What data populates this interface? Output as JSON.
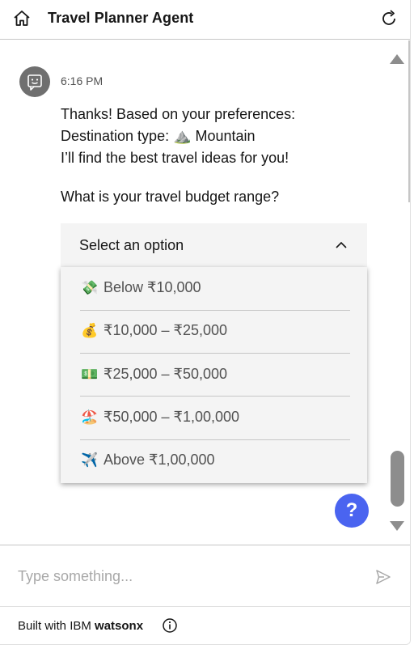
{
  "header": {
    "title": "Travel Planner Agent",
    "home_icon": "home-icon",
    "restart_icon": "restart-icon"
  },
  "chat": {
    "timestamp": "6:16 PM",
    "avatar_icon": "bot-face-icon",
    "messages": [
      "Thanks! Based on your preferences:",
      "Destination type: ⛰️ Mountain",
      "I’ll find the best travel ideas for you!",
      "What is your travel budget range?"
    ],
    "select": {
      "placeholder": "Select an option",
      "options": [
        {
          "emoji": "💸",
          "label": "Below ₹10,000"
        },
        {
          "emoji": "💰",
          "label": "₹10,000 – ₹25,000"
        },
        {
          "emoji": "💵",
          "label": "₹25,000 – ₹50,000"
        },
        {
          "emoji": "🏖️",
          "label": "₹50,000 – ₹1,00,000"
        },
        {
          "emoji": "✈️",
          "label": "Above ₹1,00,000"
        }
      ]
    },
    "help_label": "?"
  },
  "input": {
    "placeholder": "Type something..."
  },
  "footer": {
    "prefix": "Built with IBM ",
    "brand": "watsonx"
  },
  "colors": {
    "accent": "#4a64f0",
    "avatar": "#6f6f6f",
    "select_bg": "#f4f4f4"
  }
}
